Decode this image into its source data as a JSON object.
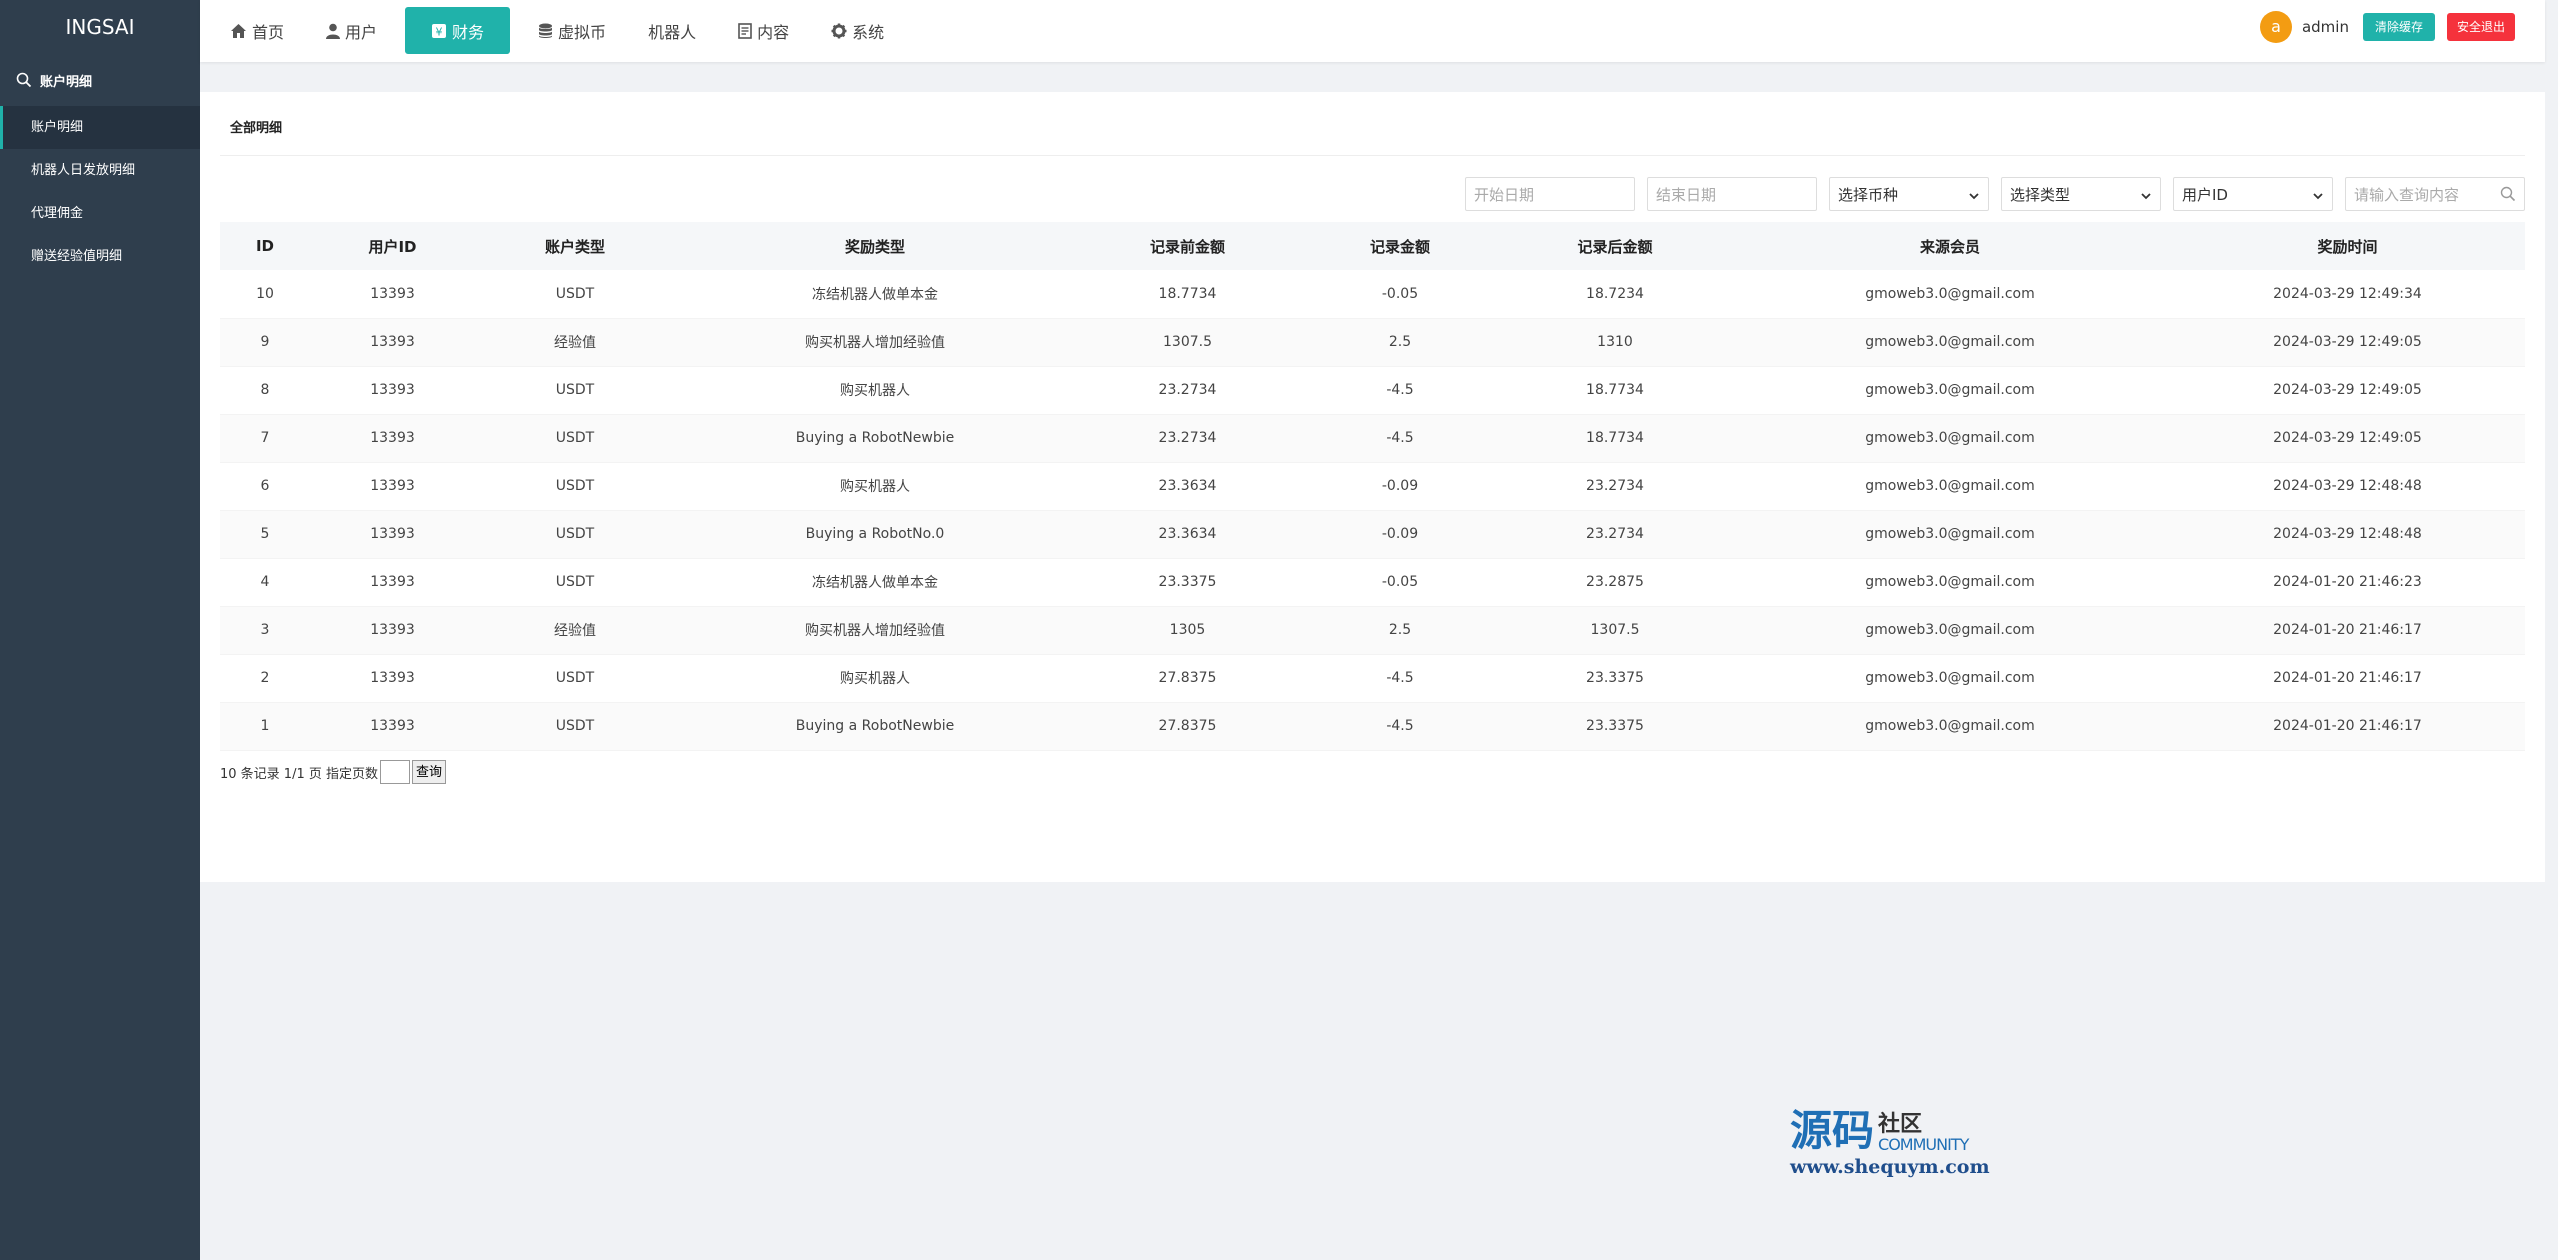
{
  "app": {
    "logo": "INGSAI"
  },
  "sidebar": {
    "group_label": "账户明细",
    "items": [
      {
        "label": "账户明细",
        "active": true
      },
      {
        "label": "机器人日发放明细"
      },
      {
        "label": "代理佣金"
      },
      {
        "label": "赠送经验值明细"
      }
    ]
  },
  "nav": {
    "items": [
      {
        "label": "首页",
        "icon": "home-icon"
      },
      {
        "label": "用户",
        "icon": "user-icon"
      },
      {
        "label": "财务",
        "icon": "finance-icon",
        "active": true
      },
      {
        "label": "虚拟币",
        "icon": "database-icon"
      },
      {
        "label": "机器人",
        "icon": ""
      },
      {
        "label": "内容",
        "icon": "document-icon"
      },
      {
        "label": "系统",
        "icon": "gear-icon"
      }
    ]
  },
  "header": {
    "avatar_letter": "a",
    "username": "admin",
    "clear_cache": "清除缓存",
    "logout": "安全退出"
  },
  "card": {
    "title": "全部明细"
  },
  "filters": {
    "start_date": "开始日期",
    "end_date": "结束日期",
    "currency": "选择币种",
    "type": "选择类型",
    "user_field": "用户ID",
    "search_placeholder": "请输入查询内容"
  },
  "table": {
    "headers": [
      "ID",
      "用户ID",
      "账户类型",
      "奖励类型",
      "记录前金额",
      "记录金额",
      "记录后金额",
      "来源会员",
      "奖励时间"
    ],
    "rows": [
      [
        "10",
        "13393",
        "USDT",
        "冻结机器人做单本金",
        "18.7734",
        "-0.05",
        "18.7234",
        "gmoweb3.0@gmail.com",
        "2024-03-29 12:49:34"
      ],
      [
        "9",
        "13393",
        "经验值",
        "购买机器人增加经验值",
        "1307.5",
        "2.5",
        "1310",
        "gmoweb3.0@gmail.com",
        "2024-03-29 12:49:05"
      ],
      [
        "8",
        "13393",
        "USDT",
        "购买机器人",
        "23.2734",
        "-4.5",
        "18.7734",
        "gmoweb3.0@gmail.com",
        "2024-03-29 12:49:05"
      ],
      [
        "7",
        "13393",
        "USDT",
        "Buying a RobotNewbie",
        "23.2734",
        "-4.5",
        "18.7734",
        "gmoweb3.0@gmail.com",
        "2024-03-29 12:49:05"
      ],
      [
        "6",
        "13393",
        "USDT",
        "购买机器人",
        "23.3634",
        "-0.09",
        "23.2734",
        "gmoweb3.0@gmail.com",
        "2024-03-29 12:48:48"
      ],
      [
        "5",
        "13393",
        "USDT",
        "Buying a RobotNo.0",
        "23.3634",
        "-0.09",
        "23.2734",
        "gmoweb3.0@gmail.com",
        "2024-03-29 12:48:48"
      ],
      [
        "4",
        "13393",
        "USDT",
        "冻结机器人做单本金",
        "23.3375",
        "-0.05",
        "23.2875",
        "gmoweb3.0@gmail.com",
        "2024-01-20 21:46:23"
      ],
      [
        "3",
        "13393",
        "经验值",
        "购买机器人增加经验值",
        "1305",
        "2.5",
        "1307.5",
        "gmoweb3.0@gmail.com",
        "2024-01-20 21:46:17"
      ],
      [
        "2",
        "13393",
        "USDT",
        "购买机器人",
        "27.8375",
        "-4.5",
        "23.3375",
        "gmoweb3.0@gmail.com",
        "2024-01-20 21:46:17"
      ],
      [
        "1",
        "13393",
        "USDT",
        "Buying a RobotNewbie",
        "27.8375",
        "-4.5",
        "23.3375",
        "gmoweb3.0@gmail.com",
        "2024-01-20 21:46:17"
      ]
    ]
  },
  "pager": {
    "text": "10 条记录 1/1 页 指定页数",
    "go": "查询"
  },
  "watermark": {
    "big": "源码",
    "small": "社区",
    "community": "COMMUNITY",
    "url": "www.shequym.com"
  },
  "colors": {
    "accent": "#20b2aa",
    "sidebar": "#2f3e4d",
    "danger": "#f5323c",
    "avatar": "#f39c12"
  }
}
